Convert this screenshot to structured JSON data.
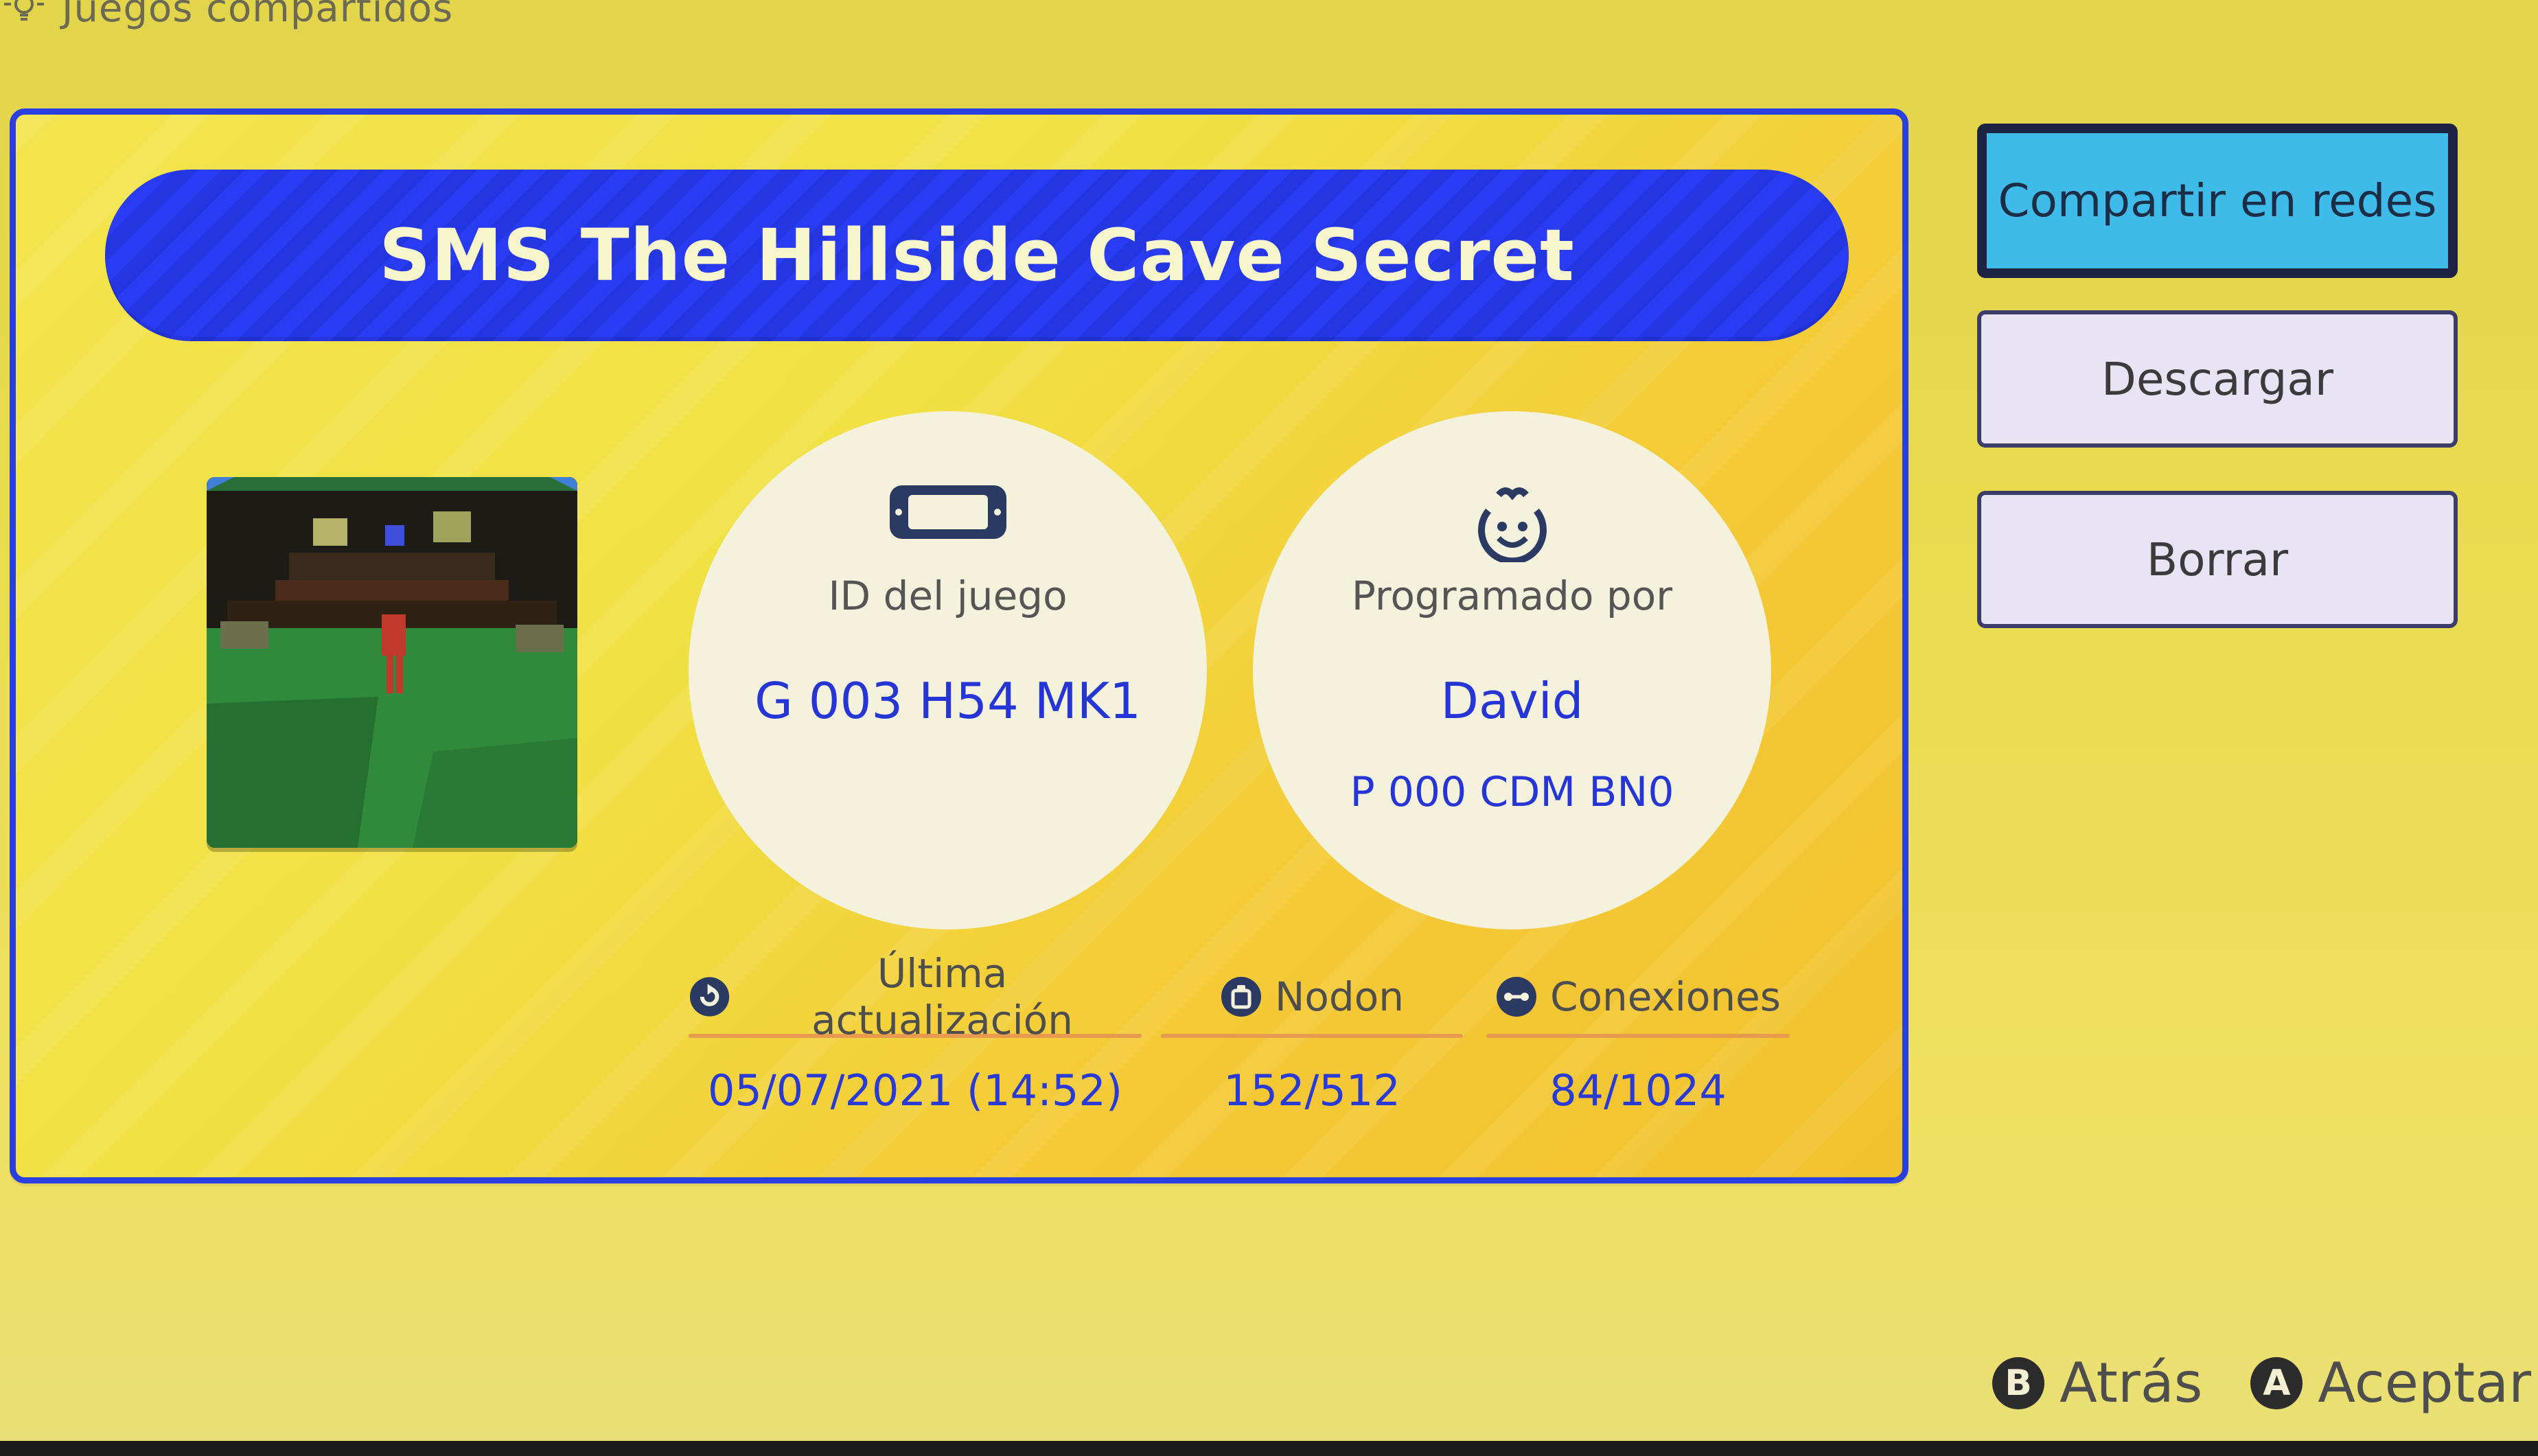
{
  "header": {
    "title": "Juegos compartidos",
    "icon": "lightbulb-icon"
  },
  "card": {
    "title": "SMS The Hillside Cave Secret",
    "thumbnail_icon": "game-thumbnail",
    "game_id": {
      "icon": "switch-console-icon",
      "label": "ID del juego",
      "value": "G 003 H54 MK1"
    },
    "author": {
      "icon": "smiley-face-icon",
      "label": "Programado por",
      "name": "David",
      "code": "P 000 CDM BN0"
    },
    "stats": {
      "updated": {
        "icon": "refresh-icon",
        "label": "Última actualización",
        "value": "05/07/2021 (14:52)"
      },
      "nodon": {
        "icon": "nodon-icon",
        "label": "Nodon",
        "value": "152/512"
      },
      "connections": {
        "icon": "connection-icon",
        "label": "Conexiones",
        "value": "84/1024"
      }
    }
  },
  "actions": {
    "share": "Compartir en redes",
    "download": "Descargar",
    "delete": "Borrar"
  },
  "controls": {
    "back": {
      "button": "B",
      "label": "Atrás"
    },
    "accept": {
      "button": "A",
      "label": "Aceptar"
    }
  },
  "colors": {
    "background": "#e6d84d",
    "card_border": "#2a3fe0",
    "banner": "#2a3cf3",
    "accent_text": "#2636d6",
    "share_button": "#3fbbe9",
    "stat_rule": "#e89a4e"
  }
}
